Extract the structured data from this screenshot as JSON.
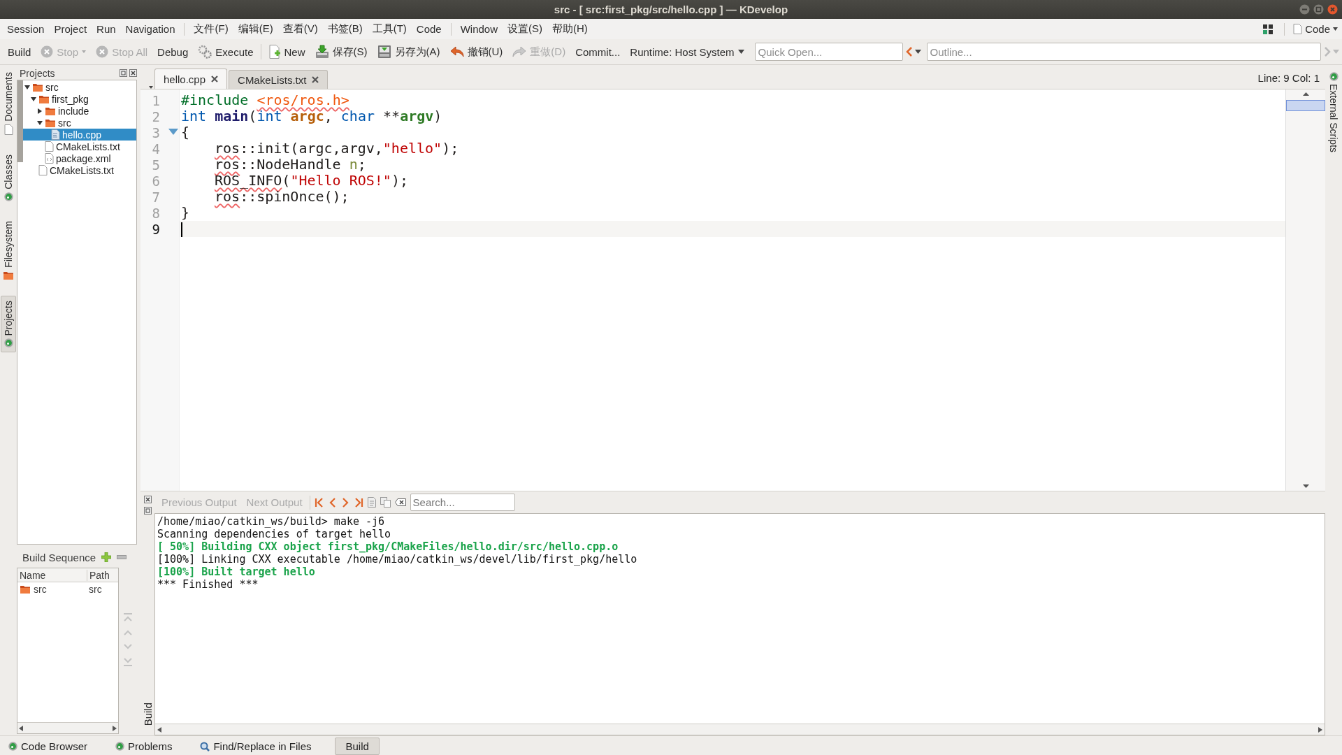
{
  "window": {
    "title": "src - [ src:first_pkg/src/hello.cpp ] — KDevelop"
  },
  "menubar": {
    "groups": [
      [
        "Session",
        "Project",
        "Run",
        "Navigation"
      ],
      [
        "文件(F)",
        "编辑(E)",
        "查看(V)",
        "书签(B)",
        "工具(T)",
        "Code"
      ],
      [
        "Window",
        "设置(S)",
        "帮助(H)"
      ]
    ],
    "area_switcher": "Code"
  },
  "toolbar": {
    "items": [
      {
        "kind": "build",
        "label": "Build",
        "disabled": false
      },
      {
        "kind": "stop",
        "label": "Stop",
        "disabled": true
      },
      {
        "kind": "stop-all",
        "label": "Stop All",
        "disabled": true
      },
      {
        "kind": "debug",
        "label": "Debug",
        "disabled": false
      },
      {
        "kind": "execute",
        "label": "Execute",
        "disabled": false
      },
      {
        "kind": "new",
        "label": "New",
        "disabled": false
      },
      {
        "kind": "save",
        "label": "保存(S)",
        "disabled": false
      },
      {
        "kind": "save-as",
        "label": "另存为(A)",
        "disabled": false
      },
      {
        "kind": "undo",
        "label": "撤销(U)",
        "disabled": false
      },
      {
        "kind": "redo",
        "label": "重做(D)",
        "disabled": true
      },
      {
        "kind": "commit",
        "label": "Commit...",
        "disabled": false
      },
      {
        "kind": "runtime",
        "label": "Runtime: Host System",
        "disabled": false
      }
    ],
    "quick_open": {
      "placeholder": "Quick Open..."
    },
    "outline": {
      "placeholder": "Outline..."
    },
    "back_disabled": false,
    "forward_disabled": true
  },
  "side_tabs_left": [
    {
      "kind": "documents",
      "label": "Documents",
      "selected": false
    },
    {
      "kind": "classes",
      "label": "Classes",
      "selected": false
    },
    {
      "kind": "filesystem",
      "label": "Filesystem",
      "selected": false
    },
    {
      "kind": "projects",
      "label": "Projects",
      "selected": true
    }
  ],
  "side_tabs_right": [
    {
      "kind": "scripts",
      "label": "External Scripts",
      "selected": false
    }
  ],
  "projects_panel": {
    "title": "Projects",
    "tree": [
      {
        "kind": "folder",
        "label": "src",
        "expanded": true,
        "selected": false,
        "children": [
          {
            "kind": "folder",
            "label": "first_pkg",
            "expanded": true,
            "selected": false,
            "children": [
              {
                "kind": "folder",
                "label": "include",
                "expanded": false,
                "selected": false
              },
              {
                "kind": "folder",
                "label": "src",
                "expanded": true,
                "selected": false,
                "children": [
                  {
                    "kind": "source",
                    "label": "hello.cpp",
                    "selected": true
                  }
                ]
              },
              {
                "kind": "file",
                "label": "CMakeLists.txt",
                "selected": false
              },
              {
                "kind": "xml",
                "label": "package.xml",
                "selected": false
              }
            ]
          },
          {
            "kind": "file",
            "label": "CMakeLists.txt",
            "selected": false
          }
        ]
      }
    ]
  },
  "build_sequence": {
    "title": "Build Sequence",
    "columns": [
      "Name",
      "Path"
    ],
    "rows": [
      {
        "kind": "folder",
        "cells": [
          "src",
          "src"
        ]
      }
    ]
  },
  "editor": {
    "tabs": [
      {
        "label": "hello.cpp",
        "selected": true
      },
      {
        "label": "CMakeLists.txt",
        "selected": false
      }
    ],
    "cursor": "Line: 9 Col: 1",
    "lines": [
      {
        "number": "1",
        "current": false,
        "fold": false,
        "indented": false,
        "tokens": [
          {
            "kind": "directive",
            "text": "#include "
          },
          {
            "kind": "include",
            "text": "<ros/ros.h>"
          }
        ]
      },
      {
        "number": "2",
        "current": false,
        "fold": false,
        "indented": false,
        "tokens": [
          {
            "kind": "type",
            "text": "int "
          },
          {
            "kind": "function",
            "text": "main"
          },
          {
            "kind": "plain",
            "text": "("
          },
          {
            "kind": "type",
            "text": "int "
          },
          {
            "kind": "param",
            "text": "argc"
          },
          {
            "kind": "plain",
            "text": ", "
          },
          {
            "kind": "type",
            "text": "char "
          },
          {
            "kind": "plain",
            "text": "**"
          },
          {
            "kind": "var",
            "text": "argv"
          },
          {
            "kind": "plain",
            "text": ")"
          }
        ]
      },
      {
        "number": "3",
        "current": false,
        "fold": true,
        "indented": false,
        "tokens": [
          {
            "kind": "plain",
            "text": "{"
          }
        ]
      },
      {
        "number": "4",
        "current": false,
        "fold": false,
        "indented": true,
        "tokens": [
          {
            "kind": "unresolved",
            "text": "ros"
          },
          {
            "kind": "plain",
            "text": "::init(argc,argv,"
          },
          {
            "kind": "string",
            "text": "\"hello\""
          },
          {
            "kind": "plain",
            "text": ");"
          }
        ]
      },
      {
        "number": "5",
        "current": false,
        "fold": false,
        "indented": true,
        "tokens": [
          {
            "kind": "unresolved",
            "text": "ros"
          },
          {
            "kind": "plain",
            "text": "::NodeHandle "
          },
          {
            "kind": "local",
            "text": "n"
          },
          {
            "kind": "plain",
            "text": ";"
          }
        ]
      },
      {
        "number": "6",
        "current": false,
        "fold": false,
        "indented": true,
        "tokens": [
          {
            "kind": "unresolved",
            "text": "ROS_INFO"
          },
          {
            "kind": "plain",
            "text": "("
          },
          {
            "kind": "string",
            "text": "\"Hello ROS!\""
          },
          {
            "kind": "plain",
            "text": ");"
          }
        ]
      },
      {
        "number": "7",
        "current": false,
        "fold": false,
        "indented": true,
        "tokens": [
          {
            "kind": "unresolved",
            "text": "ros"
          },
          {
            "kind": "plain",
            "text": "::spinOnce();"
          }
        ]
      },
      {
        "number": "8",
        "current": false,
        "fold": false,
        "indented": false,
        "tokens": [
          {
            "kind": "plain",
            "text": "}"
          }
        ]
      },
      {
        "number": "9",
        "current": true,
        "fold": false,
        "indented": false
      }
    ]
  },
  "output": {
    "title": "Build",
    "buttons": [
      {
        "label": "Previous Output",
        "disabled": true
      },
      {
        "label": "Next Output",
        "disabled": true
      }
    ],
    "search": {
      "placeholder": "Search..."
    },
    "lines": [
      {
        "kind": "plain",
        "text": "/home/miao/catkin_ws/build> make -j6"
      },
      {
        "kind": "plain",
        "text": "Scanning dependencies of target hello"
      },
      {
        "kind": "success",
        "text": "[ 50%] Building CXX object first_pkg/CMakeFiles/hello.dir/src/hello.cpp.o"
      },
      {
        "kind": "plain",
        "text": "[100%] Linking CXX executable /home/miao/catkin_ws/devel/lib/first_pkg/hello"
      },
      {
        "kind": "success",
        "text": "[100%] Built target hello"
      },
      {
        "kind": "plain",
        "text": "*** Finished ***"
      }
    ]
  },
  "bottom_tabs": [
    {
      "kind": "code-browser",
      "label": "Code Browser",
      "selected": false
    },
    {
      "kind": "problems",
      "label": "Problems",
      "selected": false
    },
    {
      "kind": "find",
      "label": "Find/Replace in Files",
      "selected": false
    },
    {
      "kind": "build",
      "label": "Build",
      "selected": true
    }
  ]
}
